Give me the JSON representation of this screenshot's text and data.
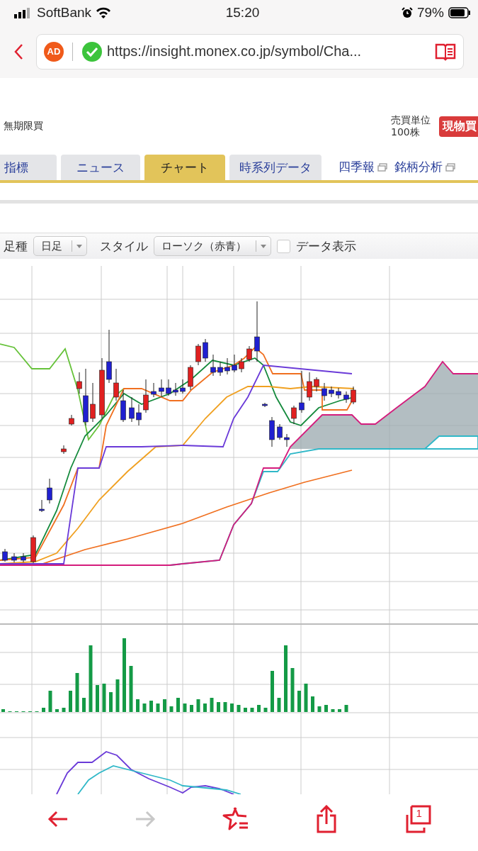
{
  "status_bar": {
    "carrier": "SoftBank",
    "time": "15:20",
    "battery": "79%"
  },
  "browser": {
    "ad_badge": "AD",
    "url": "https://insight.monex.co.jp/symbol/Cha..."
  },
  "header": {
    "label": "無期限買",
    "unit_label": "売買単位",
    "unit_value": "100株",
    "buy_button": "現物買"
  },
  "tabs": [
    {
      "label": "指標",
      "selected": false
    },
    {
      "label": "ニュース",
      "selected": false
    },
    {
      "label": "チャート",
      "selected": true
    },
    {
      "label": "時系列データ",
      "selected": false
    }
  ],
  "links": [
    "四季報",
    "銘柄分析"
  ],
  "controls": {
    "interval_label": "足種",
    "interval_value": "日足",
    "style_label": "スタイル",
    "style_value": "ローソク（赤青）",
    "data_display": {
      "label": "データ表示",
      "checked": false
    }
  },
  "toolbar": {
    "forward_disabled": true,
    "tab_count": "1"
  }
}
